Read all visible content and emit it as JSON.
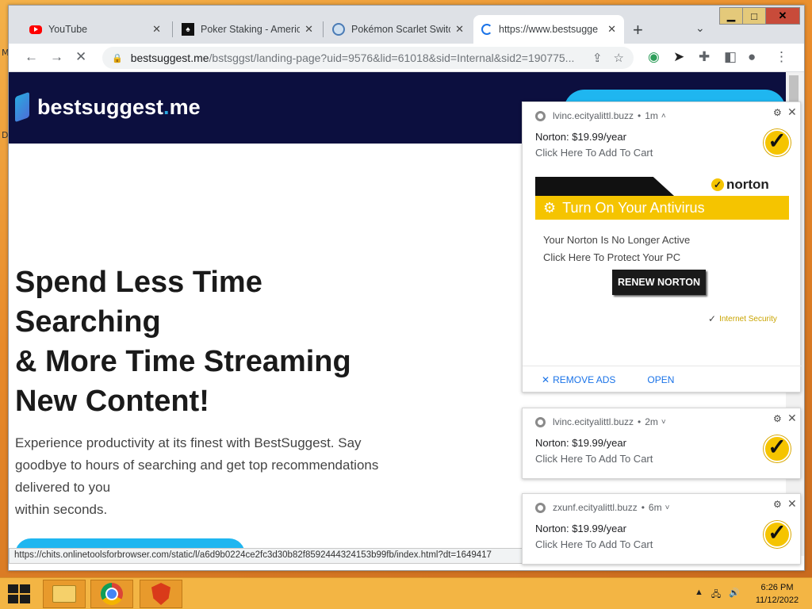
{
  "desktop": {
    "side_letters": [
      "M",
      "D"
    ]
  },
  "window_controls": {
    "minimize": "▁",
    "maximize": "□",
    "close": "✕"
  },
  "tabs": [
    {
      "title": "YouTube",
      "icon": "youtube-icon"
    },
    {
      "title": "Poker Staking - America",
      "icon": "poker-icon"
    },
    {
      "title": "Pokémon Scarlet Switch",
      "icon": "pokemon-icon"
    },
    {
      "title": "https://www.bestsugge",
      "icon": "loading-icon"
    }
  ],
  "toolbar": {
    "back": "←",
    "forward": "→",
    "stop": "✕",
    "url_host": "bestsuggest.me",
    "url_path": "/bstsggst/landing-page?uid=9576&lid=61018&sid=Internal&sid2=190775...",
    "newtab": "+",
    "tab_menu": "⌄"
  },
  "site": {
    "logo_main": "bestsuggest",
    "logo_dot": ".",
    "logo_tld": "me",
    "hero_title_lines": [
      "Spend Less Time",
      "Searching",
      "& More Time Streaming",
      "New Content!"
    ],
    "hero_desc_lines": [
      "Experience productivity at its finest with BestSuggest. Say",
      "goodbye to hours of searching and get top recommendations",
      "delivered to you",
      "within seconds."
    ]
  },
  "status_url": "https://chits.onlinetoolsforbrowser.com/static/l/a6d9b0224ce2fc3d30b82f8592444324153b99fb/index.html?dt=1649417",
  "notifications": [
    {
      "site": "lvinc.ecityalittl.buzz",
      "age": "1m",
      "chevron": "˄",
      "title": "Norton: $19.99/year",
      "body": "Click Here To Add To Cart",
      "banner": {
        "brand": "norton",
        "headline": "Turn On Your Antivirus",
        "line1": "Your Norton Is No Longer Active",
        "line2": "Click Here To Protect Your PC",
        "button": "RENEW NORTON",
        "footer": "Internet Security"
      },
      "actions": {
        "remove": "REMOVE ADS",
        "open": "OPEN"
      }
    },
    {
      "site": "lvinc.ecityalittl.buzz",
      "age": "2m",
      "chevron": "˅",
      "title": "Norton: $19.99/year",
      "body": "Click Here To Add To Cart"
    },
    {
      "site": "zxunf.ecityalittl.buzz",
      "age": "6m",
      "chevron": "˅",
      "title": "Norton: $19.99/year",
      "body": "Click Here To Add To Cart"
    }
  ],
  "taskbar": {
    "time": "6:26 PM",
    "date": "11/12/2022"
  }
}
